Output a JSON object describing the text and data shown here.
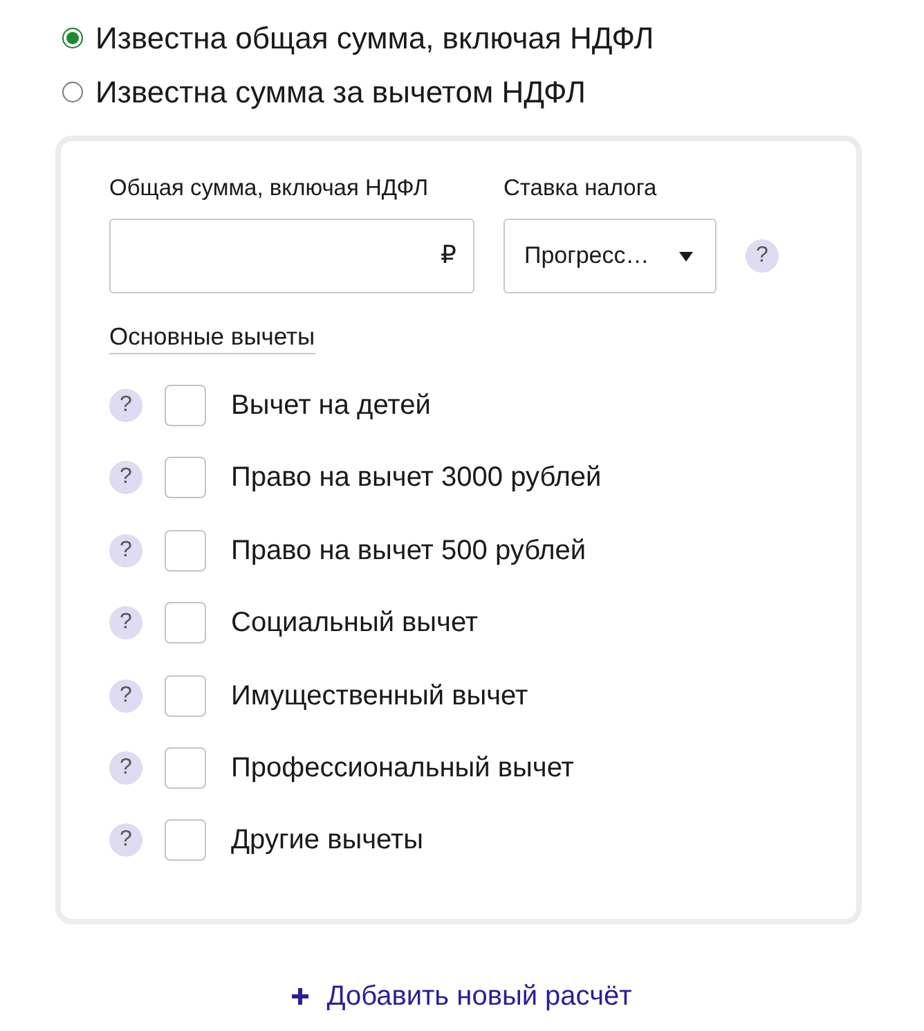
{
  "mode_options": [
    {
      "label": "Известна общая сумма, включая НДФЛ",
      "selected": true
    },
    {
      "label": "Известна сумма за вычетом НДФЛ",
      "selected": false
    }
  ],
  "form": {
    "amount": {
      "label": "Общая сумма, включая НДФЛ",
      "currency": "₽"
    },
    "rate": {
      "label": "Ставка налога",
      "value": "Прогресс…",
      "help": "?"
    },
    "deductions_title": "Основные вычеты",
    "deductions": [
      {
        "help": "?",
        "label": "Вычет на детей",
        "checked": false
      },
      {
        "help": "?",
        "label": "Право на вычет 3000 рублей",
        "checked": false
      },
      {
        "help": "?",
        "label": "Право на вычет 500 рублей",
        "checked": false
      },
      {
        "help": "?",
        "label": "Социальный вычет",
        "checked": false
      },
      {
        "help": "?",
        "label": "Имущественный вычет",
        "checked": false
      },
      {
        "help": "?",
        "label": "Профессиональный вычет",
        "checked": false
      },
      {
        "help": "?",
        "label": "Другие вычеты",
        "checked": false
      }
    ]
  },
  "add_button": {
    "label": "Добавить новый расчёт"
  }
}
